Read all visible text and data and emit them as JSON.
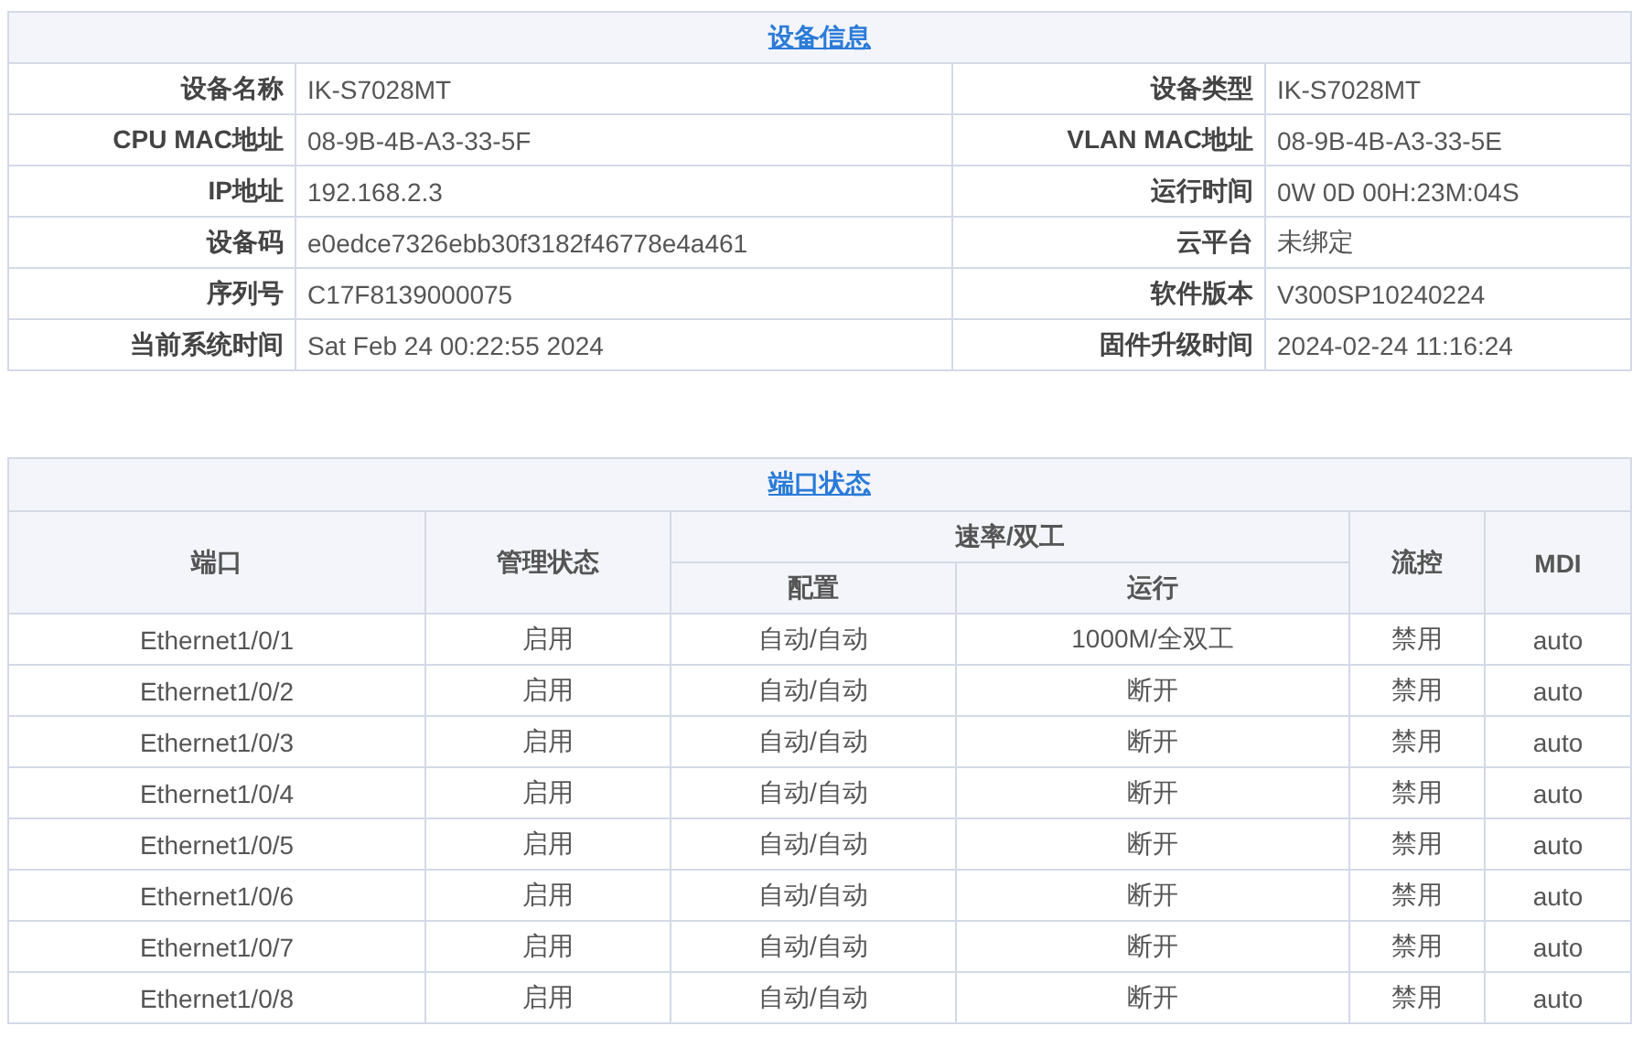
{
  "device_info": {
    "title": "设备信息",
    "rows": [
      [
        {
          "label": "设备名称",
          "value": "IK-S7028MT"
        },
        {
          "label": "设备类型",
          "value": "IK-S7028MT"
        }
      ],
      [
        {
          "label": "CPU MAC地址",
          "value": "08-9B-4B-A3-33-5F"
        },
        {
          "label": "VLAN MAC地址",
          "value": "08-9B-4B-A3-33-5E"
        }
      ],
      [
        {
          "label": "IP地址",
          "value": "192.168.2.3"
        },
        {
          "label": "运行时间",
          "value": "0W 0D 00H:23M:04S"
        }
      ],
      [
        {
          "label": "设备码",
          "value": "e0edce7326ebb30f3182f46778e4a461"
        },
        {
          "label": "云平台",
          "value": "未绑定"
        }
      ],
      [
        {
          "label": "序列号",
          "value": "C17F8139000075"
        },
        {
          "label": "软件版本",
          "value": "V300SP10240224"
        }
      ],
      [
        {
          "label": "当前系统时间",
          "value": "Sat Feb 24 00:22:55 2024"
        },
        {
          "label": "固件升级时间",
          "value": "2024-02-24 11:16:24"
        }
      ]
    ]
  },
  "port_status": {
    "title": "端口状态",
    "columns": {
      "port": "端口",
      "admin": "管理状态",
      "speed_duplex": "速率/双工",
      "config": "配置",
      "running": "运行",
      "flow_control": "流控",
      "mdi": "MDI"
    },
    "rows": [
      {
        "port": "Ethernet1/0/1",
        "admin": "启用",
        "config": "自动/自动",
        "running": "1000M/全双工",
        "flow_control": "禁用",
        "mdi": "auto"
      },
      {
        "port": "Ethernet1/0/2",
        "admin": "启用",
        "config": "自动/自动",
        "running": "断开",
        "flow_control": "禁用",
        "mdi": "auto"
      },
      {
        "port": "Ethernet1/0/3",
        "admin": "启用",
        "config": "自动/自动",
        "running": "断开",
        "flow_control": "禁用",
        "mdi": "auto"
      },
      {
        "port": "Ethernet1/0/4",
        "admin": "启用",
        "config": "自动/自动",
        "running": "断开",
        "flow_control": "禁用",
        "mdi": "auto"
      },
      {
        "port": "Ethernet1/0/5",
        "admin": "启用",
        "config": "自动/自动",
        "running": "断开",
        "flow_control": "禁用",
        "mdi": "auto"
      },
      {
        "port": "Ethernet1/0/6",
        "admin": "启用",
        "config": "自动/自动",
        "running": "断开",
        "flow_control": "禁用",
        "mdi": "auto"
      },
      {
        "port": "Ethernet1/0/7",
        "admin": "启用",
        "config": "自动/自动",
        "running": "断开",
        "flow_control": "禁用",
        "mdi": "auto"
      },
      {
        "port": "Ethernet1/0/8",
        "admin": "启用",
        "config": "自动/自动",
        "running": "断开",
        "flow_control": "禁用",
        "mdi": "auto"
      }
    ]
  }
}
